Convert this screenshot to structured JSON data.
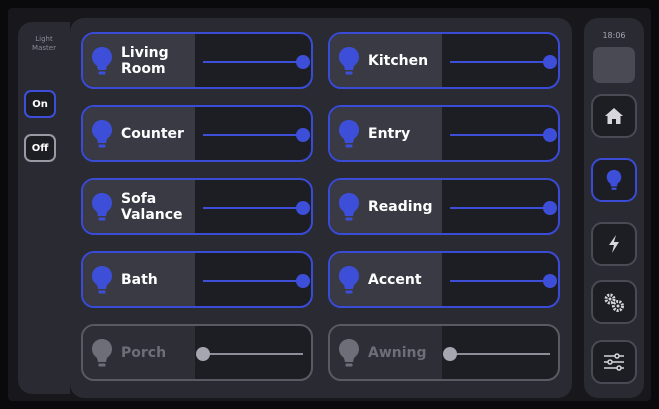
{
  "master": {
    "title": "Light\nMaster",
    "on_label": "On",
    "off_label": "Off"
  },
  "lights": [
    {
      "label": "Living\nRoom",
      "on": true,
      "level": 100
    },
    {
      "label": "Kitchen",
      "on": true,
      "level": 100
    },
    {
      "label": "Counter",
      "on": true,
      "level": 100
    },
    {
      "label": "Entry",
      "on": true,
      "level": 100
    },
    {
      "label": "Sofa\nValance",
      "on": true,
      "level": 100
    },
    {
      "label": "Reading",
      "on": true,
      "level": 100
    },
    {
      "label": "Bath",
      "on": true,
      "level": 100
    },
    {
      "label": "Accent",
      "on": true,
      "level": 100
    },
    {
      "label": "Porch",
      "on": false,
      "level": 0
    },
    {
      "label": "Awning",
      "on": false,
      "level": 0
    }
  ],
  "sidebar": {
    "time": "18:06",
    "nav": [
      {
        "icon": "home-icon",
        "active": false
      },
      {
        "icon": "bulb-icon",
        "active": true
      },
      {
        "icon": "lightning-icon",
        "active": false
      },
      {
        "icon": "gears-icon",
        "active": false
      },
      {
        "icon": "sliders-icon",
        "active": false
      }
    ]
  },
  "colors": {
    "accent": "#3d4fd8",
    "background": "#2a2a33",
    "card": "#1d1d24",
    "inactive": "#8e8e98"
  }
}
